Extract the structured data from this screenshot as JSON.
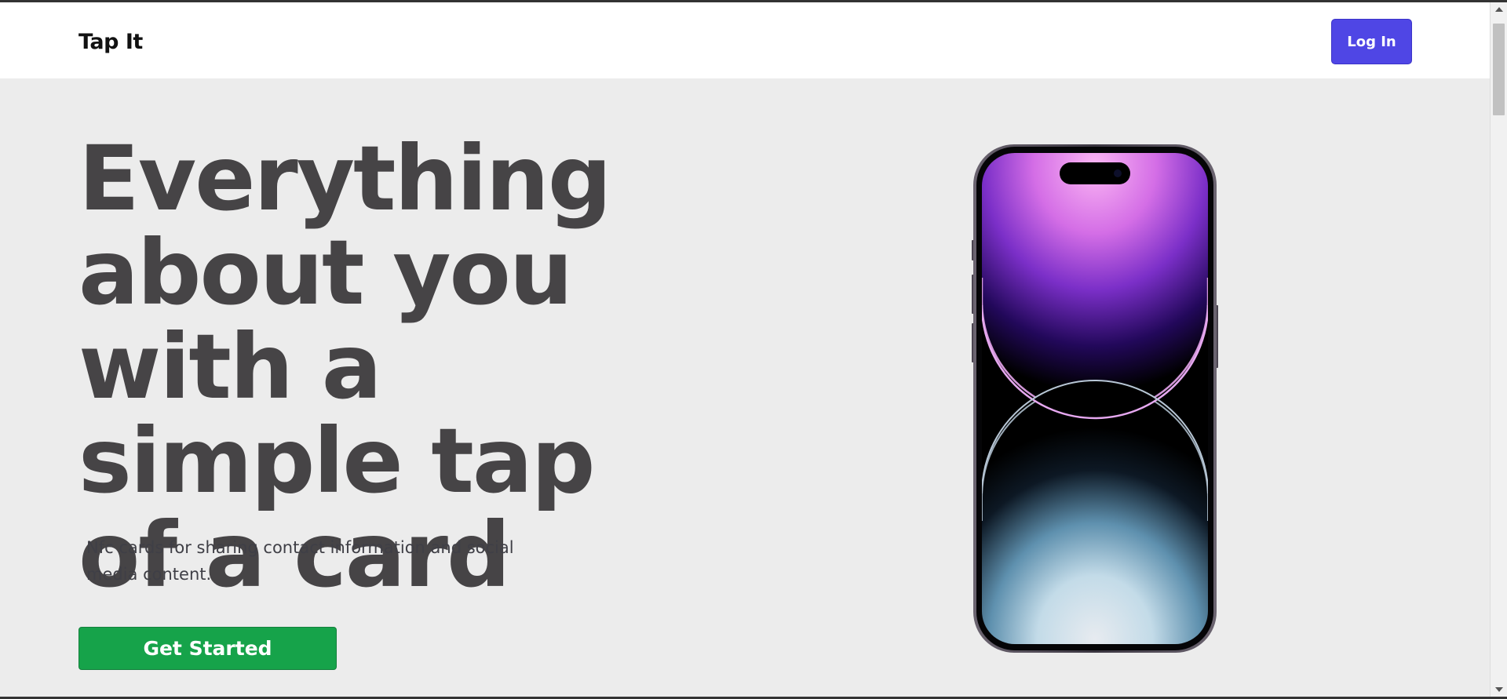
{
  "app": {
    "brand": "Tap It"
  },
  "header": {
    "login_label": "Log In"
  },
  "hero": {
    "headline": "Everything about you with a simple tap of a card",
    "subtext": "Nfc cards for sharing contact information and social media content.",
    "cta_label": "Get Started"
  },
  "colors": {
    "accent": "#4f46e5",
    "cta": "#16a34a",
    "hero_background": "#ececec",
    "headline": "#464446"
  },
  "icons": {
    "phone_image": "iphone-deep-purple-image"
  }
}
